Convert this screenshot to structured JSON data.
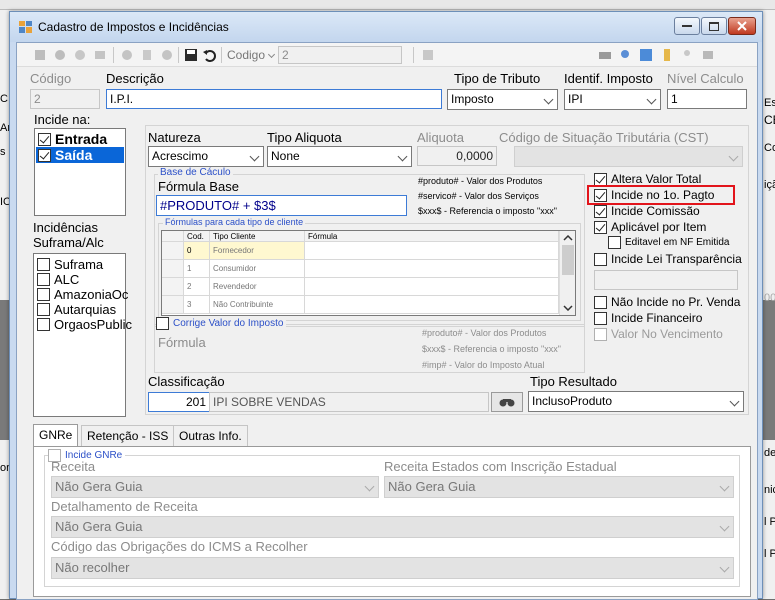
{
  "window": {
    "title": "Cadastro de Impostos e Incidências"
  },
  "toolbar": {
    "codigo_label": "Codigo",
    "codigo_value": "2"
  },
  "header": {
    "codigo_label": "Código",
    "codigo_value": "2",
    "descricao_label": "Descrição",
    "descricao_value": "I.P.I.",
    "tipo_tributo_label": "Tipo de Tributo",
    "tipo_tributo_value": "Imposto",
    "identif_label": "Identif. Imposto",
    "identif_value": "IPI",
    "nivel_label": "Nível Calculo",
    "nivel_value": "1"
  },
  "incide": {
    "label": "Incide na:",
    "items": [
      {
        "label": "Entrada",
        "checked": true
      },
      {
        "label": "Saída",
        "checked": true
      }
    ]
  },
  "suframa": {
    "label1": "Incidências",
    "label2": "Suframa/Alc",
    "items": [
      "Suframa",
      "ALC",
      "AmazoniaOc",
      "Autarquias",
      "OrgaosPublic"
    ]
  },
  "natureza": {
    "label": "Natureza",
    "value": "Acrescimo"
  },
  "tipo_aliquota": {
    "label": "Tipo Aliquota",
    "value": "None"
  },
  "aliquota": {
    "label": "Aliquota",
    "value": "0,0000"
  },
  "cst": {
    "label": "Código de Situação Tributária (CST)"
  },
  "base": {
    "group_label": "Base de Cáculo",
    "formula_label": "Fórmula Base",
    "formula_value": "#PRODUTO# + $3$",
    "help": [
      "#produto# - Valor dos Produtos",
      "#servico# - Valor dos Serviços",
      "$xxx$ - Referencia o imposto \"xxx\""
    ],
    "tipos_label": "Fórmulas para cada tipo de cliente",
    "grid_headers": [
      "Cod.",
      "Tipo Cliente",
      "Fórmula"
    ],
    "grid_rows": [
      {
        "cod": "0",
        "tipo": "Fornecedor"
      },
      {
        "cod": "1",
        "tipo": "Consumidor"
      },
      {
        "cod": "2",
        "tipo": "Revendedor"
      },
      {
        "cod": "3",
        "tipo": "Não Contribuinte"
      }
    ]
  },
  "options": {
    "altera": "Altera Valor Total",
    "incide_pagto": "Incide no 1o. Pagto",
    "incide_comissao": "Incide Comissão",
    "aplicavel": "Aplicável por Item",
    "editavel": "Editavel em NF Emitida",
    "lei": "Incide Lei Transparência",
    "nao_incide": "Não Incide no Pr. Venda",
    "financeiro": "Incide Financeiro",
    "vencimento": "Valor No Vencimento"
  },
  "corrige": {
    "label": "Corrige Valor do Imposto",
    "formula_label": "Fórmula",
    "help": [
      "#produto# - Valor dos Produtos",
      "$xxx$ - Referencia o imposto \"xxx\"",
      "#imp# - Valor do Imposto Atual"
    ]
  },
  "classificacao": {
    "label": "Classificação",
    "code": "201",
    "desc": "IPI SOBRE VENDAS"
  },
  "tipo_resultado": {
    "label": "Tipo Resultado",
    "value": "InclusoProduto"
  },
  "tabs": [
    "GNRe",
    "Retenção - ISS",
    "Outras Info."
  ],
  "gnre": {
    "incide_label": "Incide GNRe",
    "receita_label": "Receita",
    "receita_value": "Não Gera Guia",
    "receita_estados_label": "Receita Estados com Inscrição Estadual",
    "receita_estados_value": "Não Gera Guia",
    "detalhamento_label": "Detalhamento de Receita",
    "detalhamento_value": "Não Gera Guia",
    "codigo_obrig_label": "Código das Obrigações do ICMS a Recolher",
    "codigo_obrig_value": "Não recolher"
  },
  "background": {
    "left_texts": [
      "Arqu",
      "C",
      "s",
      "IO",
      "or"
    ],
    "right_texts": [
      "Esta",
      "CE",
      "Co",
      "ição",
      "00",
      "de",
      "nic",
      "l P",
      "l P"
    ]
  }
}
